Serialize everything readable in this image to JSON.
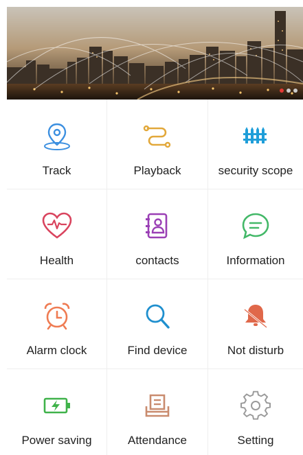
{
  "banner": {
    "alt": "",
    "dots": 3,
    "active_dot": 0
  },
  "menu": [
    {
      "key": "track",
      "label": "Track",
      "icon": "location-pin-icon",
      "color": "#3b8fe0"
    },
    {
      "key": "playback",
      "label": "Playback",
      "icon": "route-icon",
      "color": "#e2a83a"
    },
    {
      "key": "security-scope",
      "label": "security scope",
      "icon": "fence-icon",
      "color": "#1e9ed9"
    },
    {
      "key": "health",
      "label": "Health",
      "icon": "heart-pulse-icon",
      "color": "#d9445e"
    },
    {
      "key": "contacts",
      "label": "contacts",
      "icon": "contacts-book-icon",
      "color": "#9a3fb5"
    },
    {
      "key": "information",
      "label": "Information",
      "icon": "chat-bubble-icon",
      "color": "#43b868"
    },
    {
      "key": "alarm-clock",
      "label": "Alarm clock",
      "icon": "alarm-clock-icon",
      "color": "#ef7b52"
    },
    {
      "key": "find-device",
      "label": "Find device",
      "icon": "magnifier-icon",
      "color": "#1f8fce"
    },
    {
      "key": "not-disturb",
      "label": "Not disturb",
      "icon": "bell-mute-icon",
      "color": "#e0684a"
    },
    {
      "key": "power-saving",
      "label": "Power saving",
      "icon": "battery-icon",
      "color": "#3fb24a"
    },
    {
      "key": "attendance",
      "label": "Attendance",
      "icon": "clipboard-icon",
      "color": "#c98b6e"
    },
    {
      "key": "setting",
      "label": "Setting",
      "icon": "gear-icon",
      "color": "#9a9a9a"
    }
  ]
}
